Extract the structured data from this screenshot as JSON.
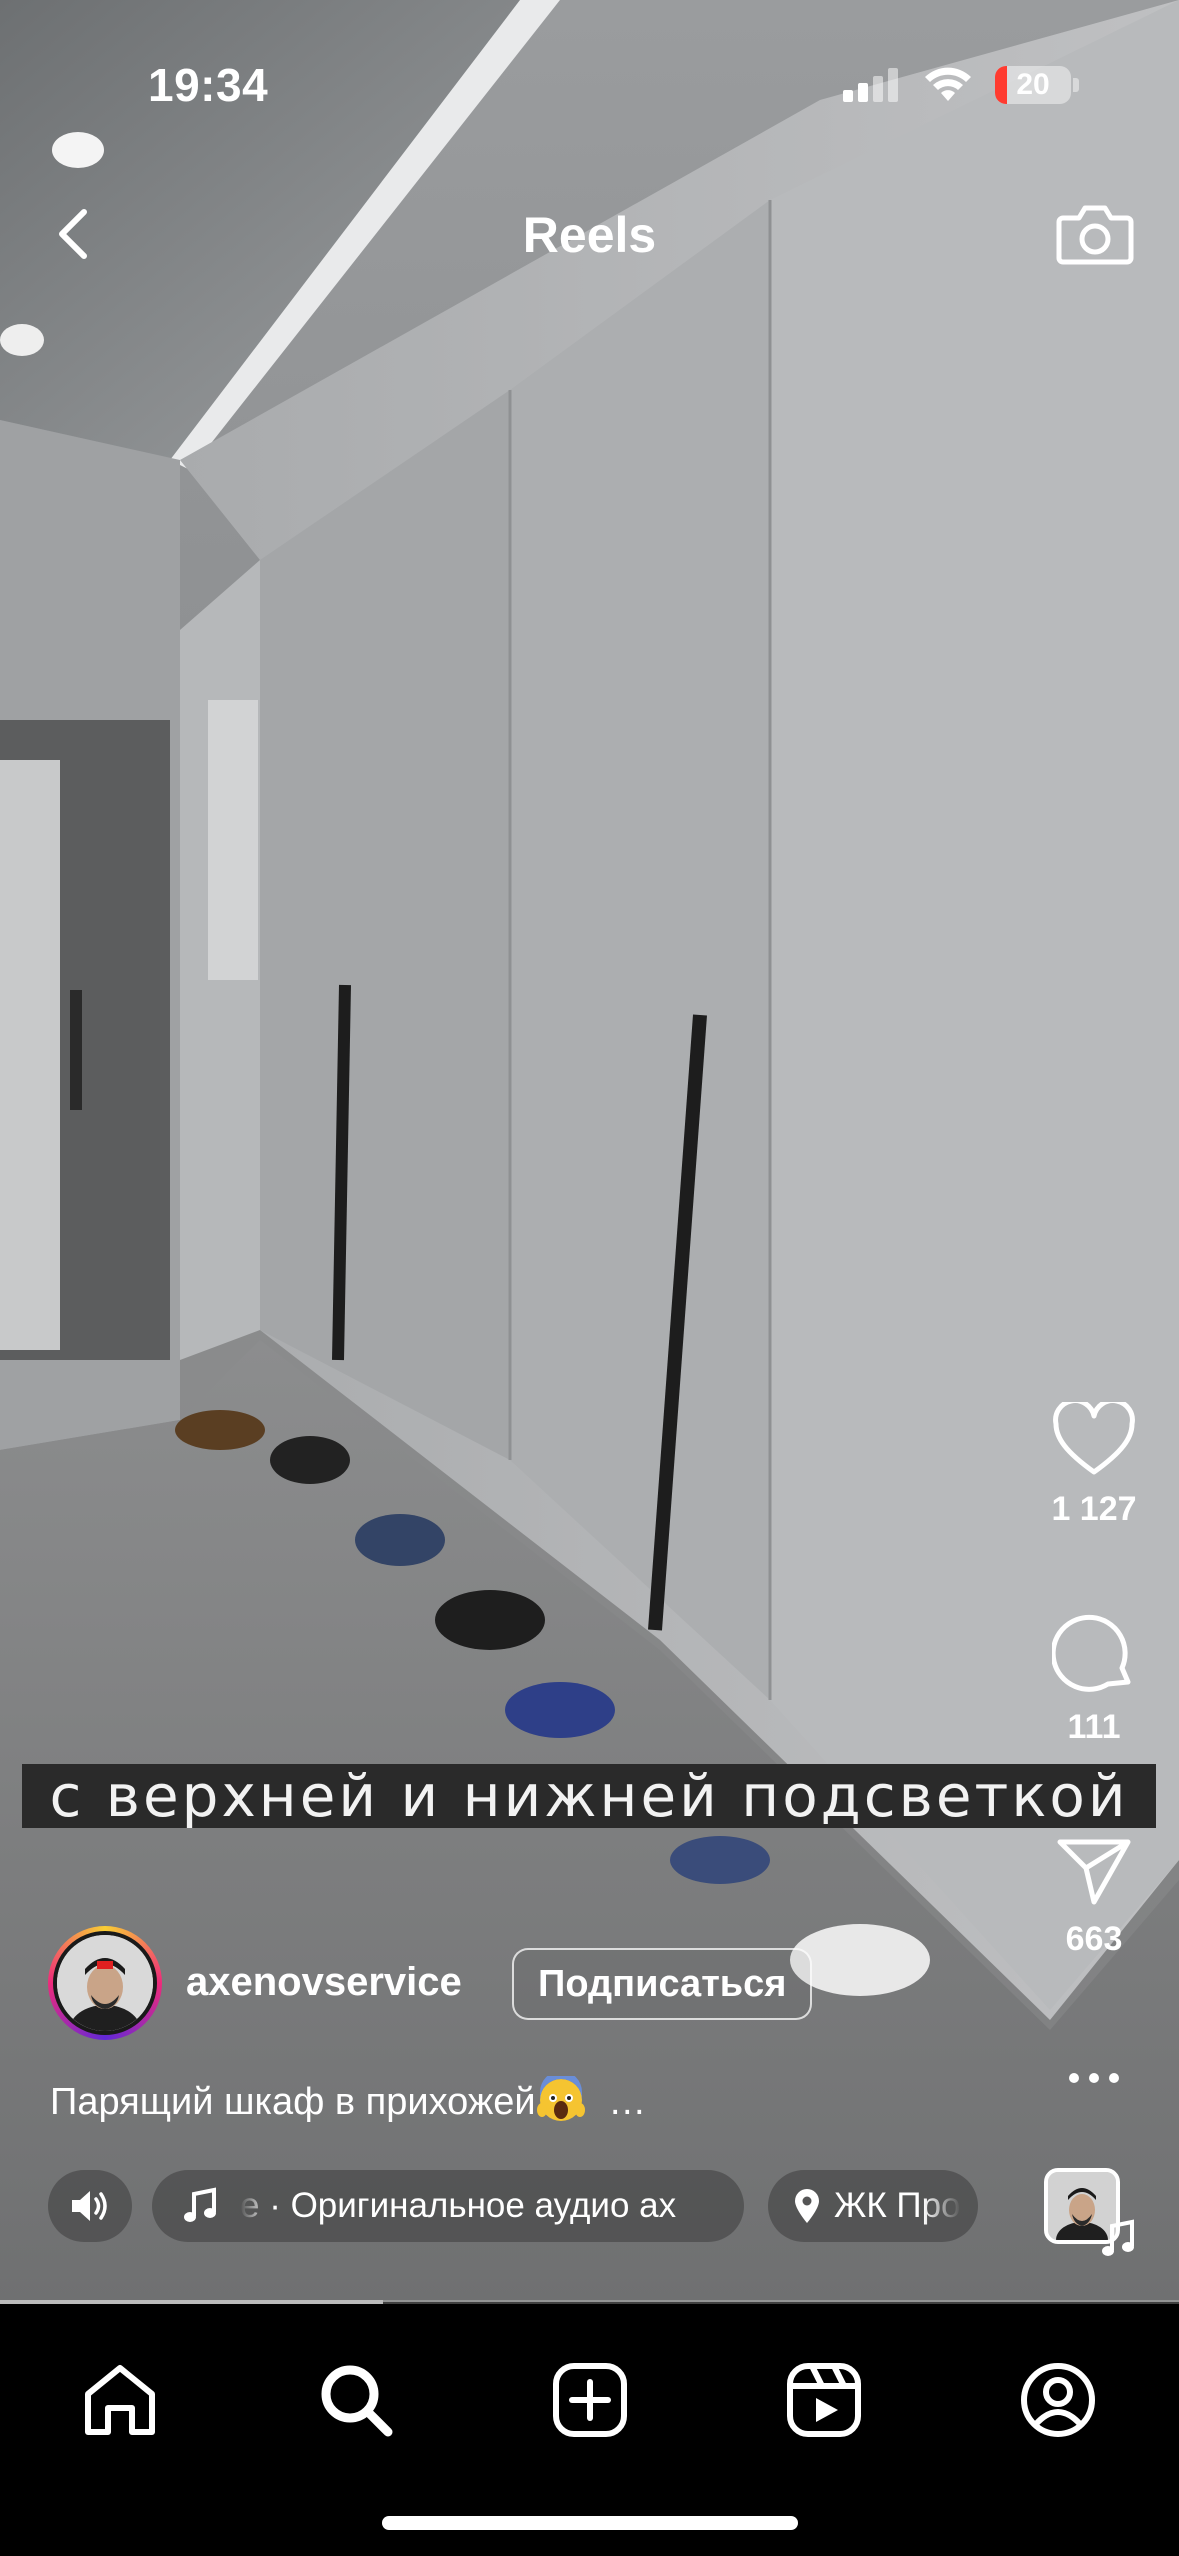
{
  "status_bar": {
    "time": "19:34",
    "battery": "20",
    "battery_level": 0.16
  },
  "header": {
    "title": "Reels"
  },
  "video": {
    "subtitle": "с верхней и нижней подсветкой",
    "progress": 0.325
  },
  "actions": {
    "likes": "1 127",
    "comments": "111",
    "shares": "663"
  },
  "author": {
    "username": "axenovservice",
    "follow_label": "Подписаться"
  },
  "post": {
    "description": "Парящий шкаф в прихожей",
    "more": "…"
  },
  "audio": {
    "label": "е · Оригинальное аудио   ах",
    "location": "ЖК Про"
  },
  "tabs": [
    "home-icon",
    "search-icon",
    "create-icon",
    "reels-icon",
    "profile-icon"
  ],
  "colors": {
    "like": "#ffffff",
    "battery_low": "#ff3b30",
    "background": "#000000"
  }
}
